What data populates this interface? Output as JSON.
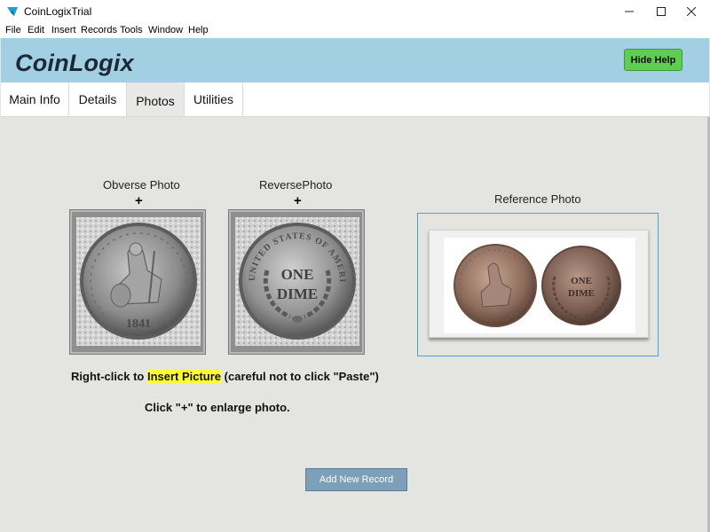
{
  "window": {
    "title": "CoinLogixTrial"
  },
  "menu": [
    "File",
    "Edit",
    "Insert",
    "Records",
    "Tools",
    "Window",
    "Help"
  ],
  "header": {
    "logo": "CoinLogix",
    "hide_help": "Hide Help"
  },
  "tabs": [
    {
      "label": "Main Info",
      "active": false
    },
    {
      "label": "Details",
      "active": false
    },
    {
      "label": "Photos",
      "active": true
    },
    {
      "label": "Utilities",
      "active": false
    }
  ],
  "photos": {
    "obverse_label": "Obverse Photo",
    "reverse_label": "ReversePhoto",
    "reference_label": "Reference Photo",
    "plus": "+",
    "obverse_date": "1841",
    "reverse_text": [
      "ONE",
      "DIME"
    ],
    "reverse_legend": "UNITED STATES OF AMERICA"
  },
  "instructions": {
    "line1_pre": "Right-click to ",
    "line1_highlight": "Insert Picture",
    "line1_post": " (careful not to click \"Paste\")",
    "line2": "Click \"+\" to enlarge photo."
  },
  "actions": {
    "add_record": "Add New Record"
  },
  "colors": {
    "header": "#a3cfe3",
    "hide_help": "#5fcd52",
    "add_button": "#7d9fb8",
    "highlight": "#ffff33",
    "ref_border": "#4aa3d4"
  },
  "icons": {
    "app": "app-logo-icon",
    "minimize": "minimize-icon",
    "maximize": "maximize-icon",
    "close": "close-icon"
  }
}
